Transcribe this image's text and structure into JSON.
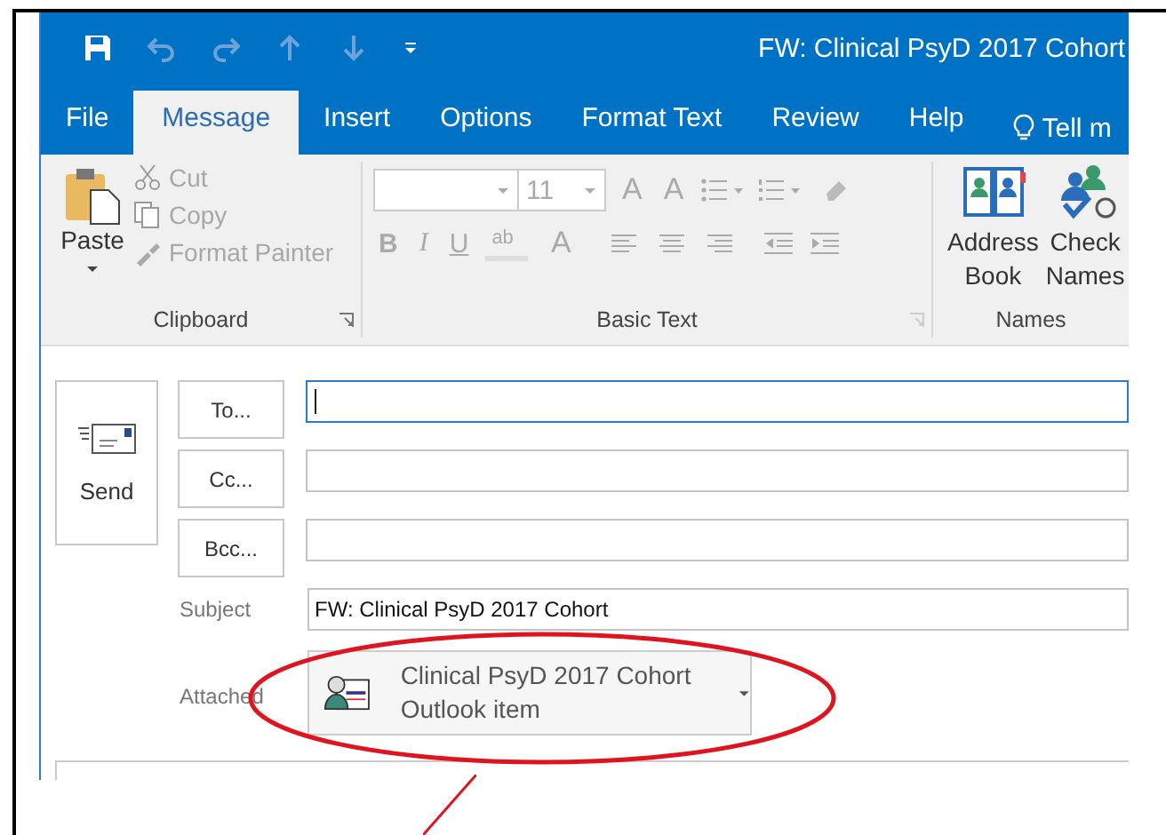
{
  "window": {
    "title": "FW: Clinical PsyD 2017 Cohort"
  },
  "tabs": [
    {
      "label": "File",
      "selected": false
    },
    {
      "label": "Message",
      "selected": true
    },
    {
      "label": "Insert",
      "selected": false
    },
    {
      "label": "Options",
      "selected": false
    },
    {
      "label": "Format Text",
      "selected": false
    },
    {
      "label": "Review",
      "selected": false
    },
    {
      "label": "Help",
      "selected": false
    },
    {
      "label": "Tell m",
      "selected": false,
      "kind": "tell_me"
    }
  ],
  "ribbon": {
    "clipboard": {
      "label": "Clipboard",
      "paste": {
        "label": "Paste",
        "disabled": false
      },
      "items": [
        {
          "label": "Cut",
          "disabled": true
        },
        {
          "label": "Copy",
          "disabled": true
        },
        {
          "label": "Format Painter",
          "disabled": true
        }
      ]
    },
    "basic_text": {
      "label": "Basic Text",
      "disabled": true,
      "font_size": "11",
      "grow": "A",
      "shrink": "A",
      "bold": "B",
      "italic": "I",
      "underline": "U",
      "highlight": "ab",
      "font_color": "A"
    },
    "names": {
      "label": "Names",
      "items": [
        {
          "line1": "Address",
          "line2": "Book"
        },
        {
          "line1": "Check",
          "line2": "Names"
        }
      ]
    }
  },
  "form": {
    "send": "Send",
    "recipients": [
      {
        "button": "To...",
        "focused": true
      },
      {
        "button": "Cc...",
        "focused": false
      },
      {
        "button": "Bcc...",
        "focused": false
      }
    ],
    "subject": {
      "label": "Subject",
      "value": "FW: Clinical PsyD 2017 Cohort"
    },
    "attached": {
      "label": "Attached",
      "name": "Clinical PsyD 2017 Cohort",
      "type": "Outlook item"
    }
  }
}
